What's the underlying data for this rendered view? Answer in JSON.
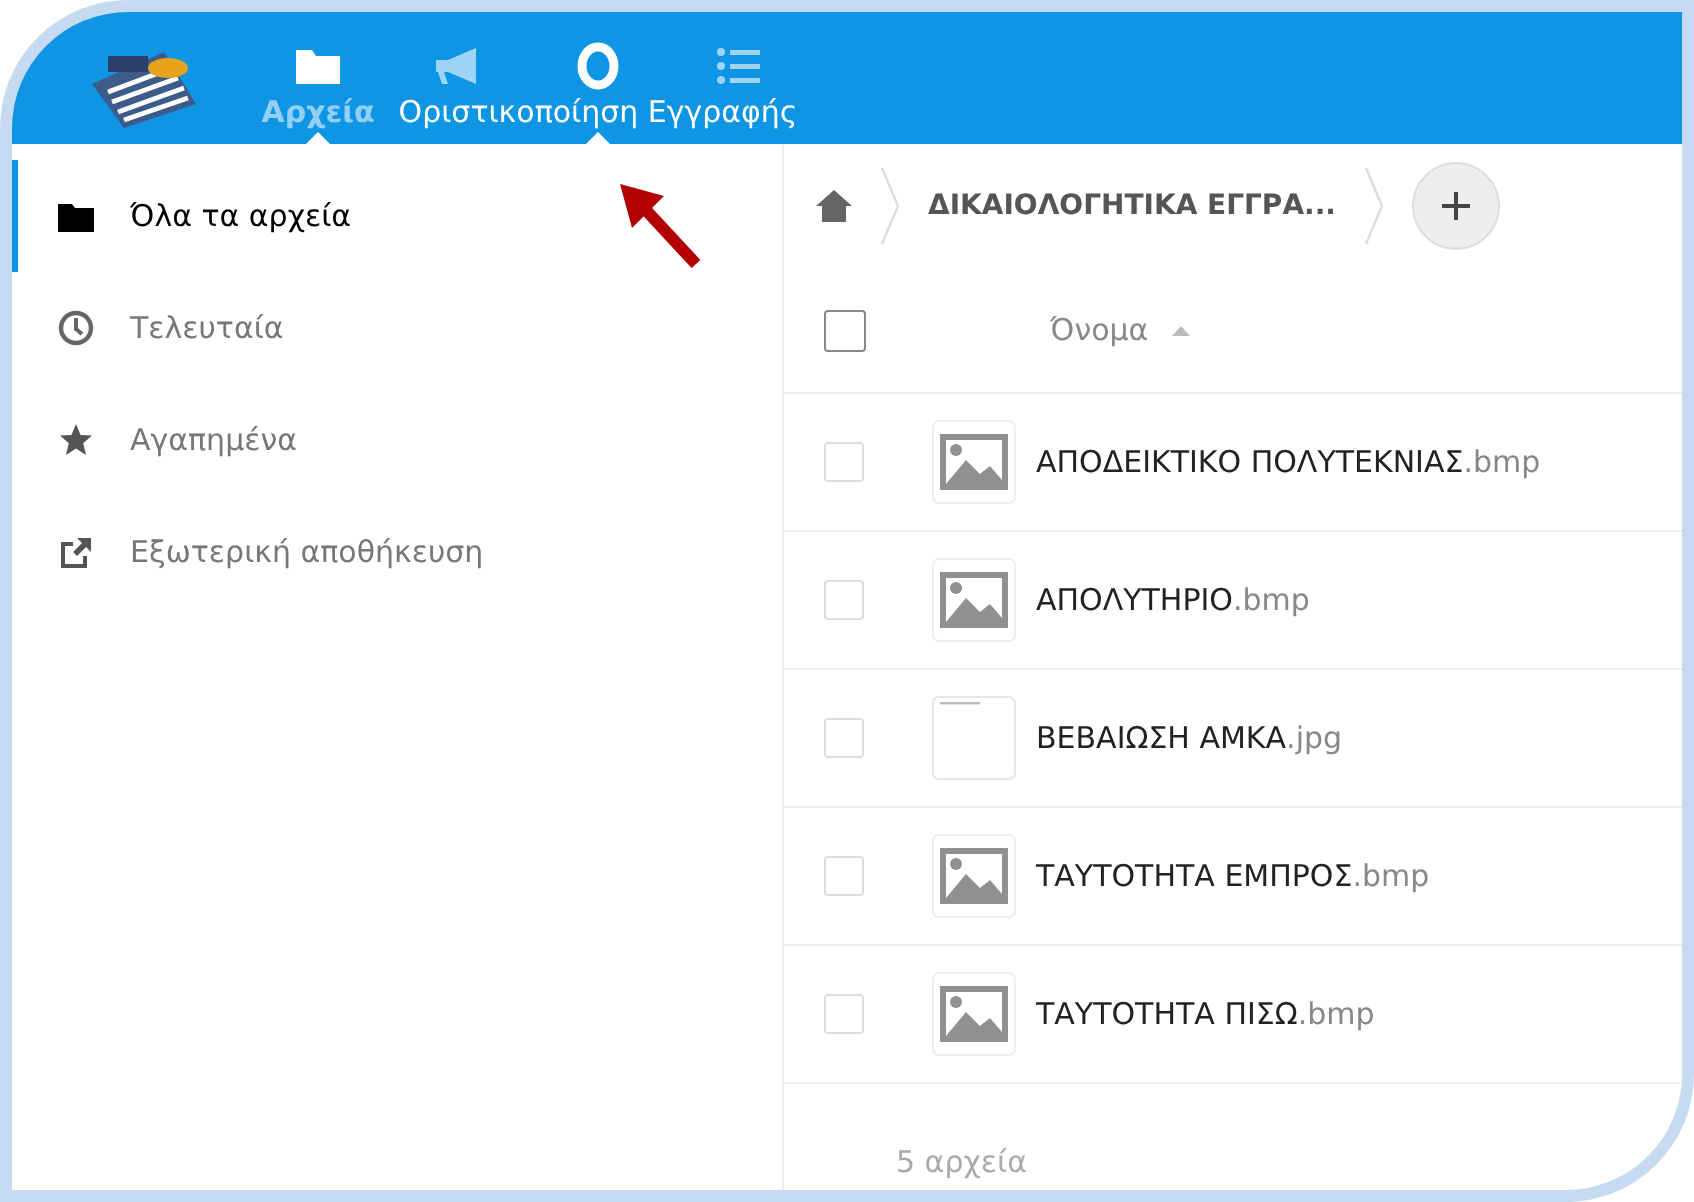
{
  "header": {
    "apps": [
      {
        "kind": "folder",
        "label": "Αρχεία",
        "selected": true,
        "hovered": false
      },
      {
        "kind": "megaphone",
        "selected": false,
        "hovered": false
      },
      {
        "kind": "circle",
        "label": "Οριστικοποίηση Εγγραφής",
        "selected": false,
        "hovered": true
      },
      {
        "kind": "list",
        "selected": false,
        "hovered": false
      }
    ]
  },
  "sidebar": {
    "items": [
      {
        "kind": "folder",
        "label": "Όλα τα αρχεία",
        "selected": true
      },
      {
        "kind": "clock",
        "label": "Τελευταία",
        "selected": false
      },
      {
        "kind": "star",
        "label": "Αγαπημένα",
        "selected": false
      },
      {
        "kind": "external",
        "label": "Εξωτερική αποθήκευση",
        "selected": false
      }
    ]
  },
  "breadcrumb": {
    "folder": "ΔΙΚΑΙΟΛΟΓΗΤΙΚΑ ΕΓΓΡΑ..."
  },
  "table": {
    "select_all_checked": false,
    "columns": [
      {
        "label": "Όνομα",
        "sorted_ascending": true
      }
    ],
    "rows": [
      {
        "name": "ΑΠΟΔΕΙΚΤΙΚΟ ΠΟΛΥΤΕΚΝΙΑΣ",
        "ext": ".bmp",
        "kind": "image",
        "checked": false
      },
      {
        "name": "ΑΠΟΛΥΤΗΡΙΟ",
        "ext": ".bmp",
        "kind": "image",
        "checked": false
      },
      {
        "name": "ΒΕΒΑΙΩΣΗ ΑΜΚΑ",
        "ext": ".jpg",
        "kind": "thumbnail",
        "checked": false
      },
      {
        "name": "ΤΑΥΤΟΤΗΤΑ ΕΜΠΡΟΣ",
        "ext": ".bmp",
        "kind": "image",
        "checked": false
      },
      {
        "name": "ΤΑΥΤΟΤΗΤΑ ΠΙΣΩ",
        "ext": ".bmp",
        "kind": "image",
        "checked": false
      }
    ],
    "summary": "5 αρχεία"
  }
}
